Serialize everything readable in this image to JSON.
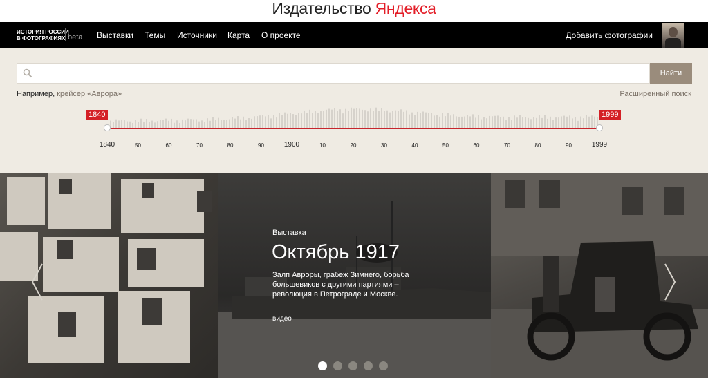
{
  "brand": {
    "part1": "Издательство",
    "part2": "Яндекса"
  },
  "site": {
    "logo_line1": "ИСТОРИЯ РОССИИ",
    "logo_line2": "В ФОТОГРАФИЯХ",
    "beta": "beta"
  },
  "nav": {
    "items": [
      "Выставки",
      "Темы",
      "Источники",
      "Карта",
      "О проекте"
    ],
    "add_photos": "Добавить фотографии"
  },
  "search": {
    "value": "",
    "placeholder": "",
    "button": "Найти"
  },
  "example": {
    "prefix": "Например,",
    "link": "крейсер «Аврора»"
  },
  "advanced_search": "Расширенный поиск",
  "timeline": {
    "start": "1840",
    "end": "1999",
    "ticks": [
      "1840",
      "50",
      "60",
      "70",
      "80",
      "90",
      "1900",
      "10",
      "20",
      "30",
      "40",
      "50",
      "60",
      "70",
      "80",
      "90",
      "1999"
    ],
    "accent": "#d42026"
  },
  "hero": {
    "kind": "Выставка",
    "title": "Октябрь 1917",
    "description": "Залп Авроры, грабеж Зимнего, борьба большевиков с другими партиями – революция в Петрограде и Москве.",
    "media": "видео",
    "slides_total": 5,
    "slide_active": 1
  },
  "icons": {
    "search": "search-icon",
    "prev": "chevron-left-icon",
    "next": "chevron-right-icon"
  }
}
